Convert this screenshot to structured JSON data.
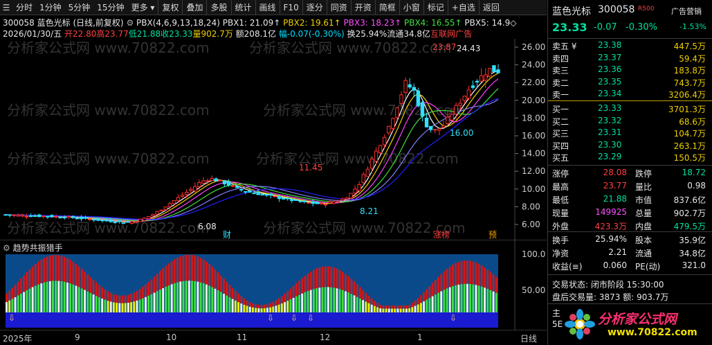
{
  "toolbar": {
    "items": [
      "分时",
      "1分钟",
      "5分钟",
      "15分钟",
      "更多",
      "复权",
      "叠加",
      "多股",
      "统计",
      "画线",
      "F10",
      "逐分",
      "同资",
      "开资",
      "简框",
      "小窗",
      "标记",
      "+自选",
      "返回"
    ]
  },
  "header": {
    "code_name": "300058 蓝色光标 (日线,前复权)",
    "pbx_params": "PBX(4,6,9,13,18,24)",
    "pbx1": "PBX1: 21.09↑",
    "pbx2": "PBX2: 19.61↑",
    "pbx3": "PBX3: 18.23↑",
    "pbx4": "PBX4: 16.55↑",
    "pbx5": "PBX5: 14.9◇",
    "date": "2026/01/30/五",
    "open": "开22.80",
    "high": "高23.77",
    "low": "低21.88",
    "close": "收23.33",
    "vol": "量902.7万",
    "amt": "额208.1亿",
    "range": "幅-0.07(-0.30%)",
    "turn": "换25.94%",
    "float": "流通34.8亿",
    "concept": "互联网广告"
  },
  "chart": {
    "price_axis": [
      "26.00",
      "24.00",
      "22.00",
      "20.00",
      "18.00",
      "16.00",
      "14.00",
      "12.00",
      "10.00",
      "8.00",
      "6.00"
    ],
    "annotations": {
      "high1": "11.45",
      "high2": "23.87",
      "high3": "24.43",
      "low1": "8.21",
      "low2": "16.00",
      "low3": "6.08"
    },
    "markers": {
      "m1": "财",
      "m2": "涨榜",
      "m3": "预"
    },
    "watermark": "分析家公式网 www.70822.com"
  },
  "indicator": {
    "title": "趋势共振猎手",
    "axis": [
      "100.0",
      "50.00"
    ]
  },
  "dates": {
    "labels": [
      "2025年",
      "9",
      "10",
      "11",
      "12",
      "1"
    ],
    "period": "日线"
  },
  "quote": {
    "name": "蓝色光标",
    "code": "300058",
    "badge": "R500",
    "concept": "广告营销",
    "price": "23.33",
    "change": "-0.07",
    "pct": "-0.30%",
    "concept_pct": "-1.53%",
    "asks": [
      {
        "label": "卖五 ¥",
        "price": "23.38",
        "vol": "447.5万"
      },
      {
        "label": "卖四",
        "price": "23.37",
        "vol": "59.4万"
      },
      {
        "label": "卖三",
        "price": "23.36",
        "vol": "183.8万"
      },
      {
        "label": "卖二",
        "price": "23.35",
        "vol": "743.7万"
      },
      {
        "label": "卖一",
        "price": "23.34",
        "vol": "3206.4万"
      }
    ],
    "bids": [
      {
        "label": "买一",
        "price": "23.33",
        "vol": "3701.3万"
      },
      {
        "label": "买二",
        "price": "23.32",
        "vol": "68.6万"
      },
      {
        "label": "买三",
        "price": "23.31",
        "vol": "104.7万"
      },
      {
        "label": "买四",
        "price": "23.30",
        "vol": "263.1万"
      },
      {
        "label": "买五",
        "price": "23.29",
        "vol": "150.5万"
      }
    ],
    "stats": [
      {
        "l1": "涨停",
        "v1": "28.08",
        "l2": "跌停",
        "v2": "18.72"
      },
      {
        "l1": "最高",
        "v1": "23.77",
        "l2": "量比",
        "v2": "0.98"
      },
      {
        "l1": "最低",
        "v1": "21.88",
        "l2": "市值",
        "v2": "837.6亿"
      },
      {
        "l1": "现量",
        "v1": "149925",
        "l2": "总量",
        "v2": "902.7万"
      },
      {
        "l1": "外盘",
        "v1": "423.3万",
        "l2": "内盘",
        "v2": "479.5万"
      }
    ],
    "stats2": [
      {
        "l1": "换手",
        "v1": "25.94%",
        "l2": "股本",
        "v2": "35.9亿"
      },
      {
        "l1": "净资",
        "v1": "2.21",
        "l2": "流通",
        "v2": "34.8亿"
      },
      {
        "l1": "收益(≡)",
        "v1": "0.060",
        "l2": "PE(动)",
        "v2": "321.0"
      }
    ],
    "trade_status": "交易状态: 闭市阶段 15:30:00",
    "after_hours": "盘后交易量: 3873  额: 903.7万",
    "tail1": "主",
    "tail2": "5E",
    "ad": "分析家公式网",
    "ad_url": "www.70822.com"
  }
}
